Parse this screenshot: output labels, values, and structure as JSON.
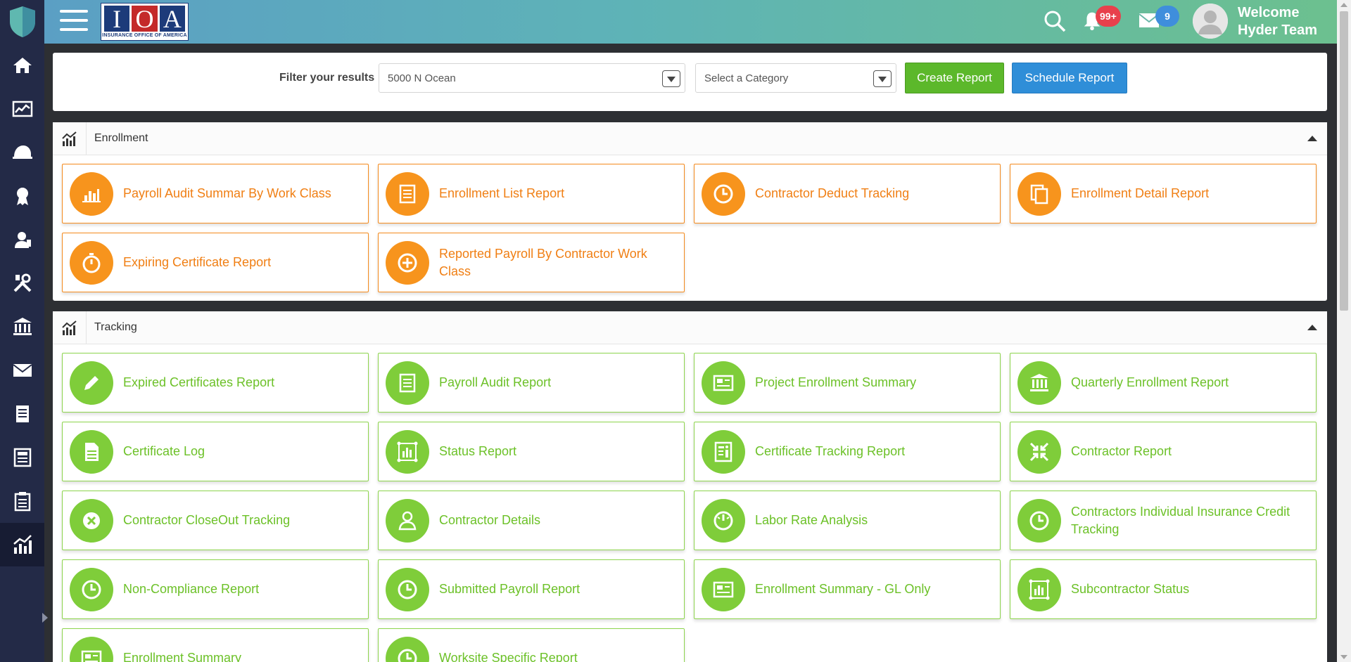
{
  "header": {
    "brand_letters": [
      "I",
      "O",
      "A"
    ],
    "brand_tagline": "INSURANCE OFFICE OF AMERICA",
    "notifications_count": "99+",
    "messages_count": "9",
    "welcome_line1": "Welcome",
    "welcome_line2": "Hyder Team"
  },
  "sidebar": {
    "items": [
      "home-icon",
      "dashboard-icon",
      "helmet-icon",
      "award-icon",
      "worker-icon",
      "tools-icon",
      "bank-icon",
      "mail-icon",
      "document-icon",
      "newspaper-icon",
      "clipboard-icon",
      "chart-icon"
    ],
    "active": "chart-icon"
  },
  "filter": {
    "label": "Filter your results",
    "project_value": "5000 N Ocean",
    "category_placeholder": "Select a Category",
    "create_label": "Create Report",
    "schedule_label": "Schedule Report"
  },
  "sections": {
    "enrollment": {
      "title": "Enrollment",
      "cards": [
        {
          "label": "Payroll Audit Summar By Work Class",
          "icon": "bar-chart-icon"
        },
        {
          "label": "Enrollment List Report",
          "icon": "list-icon"
        },
        {
          "label": "Contractor Deduct Tracking",
          "icon": "clock-icon"
        },
        {
          "label": "Enrollment Detail Report",
          "icon": "copy-icon"
        },
        {
          "label": "Expiring Certificate Report",
          "icon": "stopwatch-icon"
        },
        {
          "label": "Reported Payroll By Contractor Work Class",
          "icon": "plus-circle-icon"
        }
      ]
    },
    "tracking": {
      "title": "Tracking",
      "cards": [
        {
          "label": "Expired Certificates Report",
          "icon": "pencil-icon"
        },
        {
          "label": "Payroll Audit Report",
          "icon": "list-icon"
        },
        {
          "label": "Project Enrollment Summary",
          "icon": "newspaper-icon"
        },
        {
          "label": "Quarterly Enrollment Report",
          "icon": "bank-icon"
        },
        {
          "label": "Certificate Log",
          "icon": "file-icon"
        },
        {
          "label": "Status Report",
          "icon": "chart-frame-icon"
        },
        {
          "label": "Certificate Tracking Report",
          "icon": "info-doc-icon"
        },
        {
          "label": "Contractor Report",
          "icon": "compress-icon"
        },
        {
          "label": "Contractor CloseOut Tracking",
          "icon": "x-circle-icon"
        },
        {
          "label": "Contractor Details",
          "icon": "user-icon"
        },
        {
          "label": "Labor Rate Analysis",
          "icon": "gauge-icon"
        },
        {
          "label": "Contractors Individual Insurance Credit Tracking",
          "icon": "clock-icon"
        },
        {
          "label": "Non-Compliance Report",
          "icon": "clock-icon"
        },
        {
          "label": "Submitted Payroll Report",
          "icon": "clock-icon"
        },
        {
          "label": "Enrollment Summary - GL Only",
          "icon": "newspaper-icon"
        },
        {
          "label": "Subcontractor Status",
          "icon": "chart-frame-icon"
        },
        {
          "label": "Enrollment Summary",
          "icon": "newspaper-icon"
        },
        {
          "label": "Worksite Specific Report",
          "icon": "clock-icon"
        }
      ]
    }
  }
}
